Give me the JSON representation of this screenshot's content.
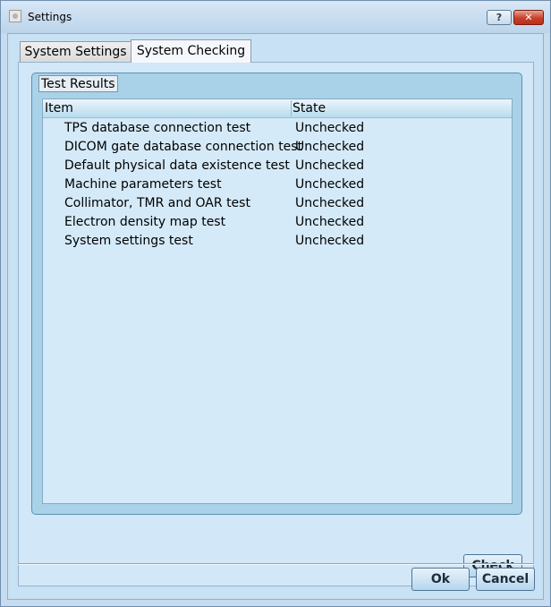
{
  "window": {
    "title": "Settings",
    "help_label": "?",
    "close_label": "✕",
    "icon": "settings-app-icon"
  },
  "tabs": [
    {
      "label": "System Settings",
      "active": false
    },
    {
      "label": "System Checking",
      "active": true
    }
  ],
  "group": {
    "title": "Test Results"
  },
  "table": {
    "columns": [
      "Item",
      "State"
    ],
    "rows": [
      {
        "item": "TPS database connection test",
        "state": "Unchecked"
      },
      {
        "item": "DICOM gate database connection test",
        "state": "Unchecked"
      },
      {
        "item": "Default physical data existence test",
        "state": "Unchecked"
      },
      {
        "item": "Machine parameters test",
        "state": "Unchecked"
      },
      {
        "item": "Collimator, TMR and OAR test",
        "state": "Unchecked"
      },
      {
        "item": "Electron density map test",
        "state": "Unchecked"
      },
      {
        "item": "System settings test",
        "state": "Unchecked"
      }
    ]
  },
  "buttons": {
    "check": "Check",
    "ok": "Ok",
    "cancel": "Cancel"
  },
  "colors": {
    "accent": "#a9d2e9",
    "close": "#c7402b"
  }
}
